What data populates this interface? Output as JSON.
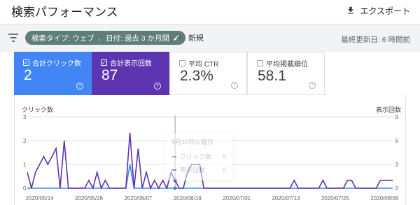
{
  "header": {
    "title": "検索パフォーマンス",
    "export_label": "エクスポート"
  },
  "filters": {
    "search_type_chip": "検索タイプ: ウェブ",
    "date_chip": "日付: 過去 3 か月間",
    "new_label": "新規",
    "last_updated": "最終更新日: 6 時間前"
  },
  "metrics": [
    {
      "label": "合計クリック数",
      "value": "2",
      "checked": true
    },
    {
      "label": "合計表示回数",
      "value": "87",
      "checked": true
    },
    {
      "label": "平均 CTR",
      "value": "2.3%",
      "checked": false
    },
    {
      "label": "平均掲載順位",
      "value": "58.1",
      "checked": false
    }
  ],
  "tooltip": {
    "date": "6月16日火曜日",
    "clicks_label": "クリック数",
    "clicks_value": "0",
    "impressions_label": "表示回数",
    "impressions_value": "0"
  },
  "chart_data": {
    "type": "line",
    "left_axis_title": "クリック数",
    "right_axis_title": "表示回数",
    "left_ticks": [
      "3",
      "2",
      "1",
      "0"
    ],
    "right_ticks": [
      "9",
      "6",
      "3",
      "0"
    ],
    "ylim_left": [
      0,
      3
    ],
    "ylim_right": [
      0,
      9
    ],
    "x_tick_labels": [
      "2020/05/14",
      "2020/05/26",
      "2020/06/07",
      "2020/06/19",
      "2020/07/01",
      "2020/07/13",
      "2020/07/25",
      "2020/08/06"
    ],
    "x_start_date": "2020/05/14",
    "x_count": 90,
    "colors": {
      "clicks": "#4285f4",
      "impressions": "#5e35b1",
      "grid": "#e0e0e0"
    },
    "series": [
      {
        "name": "クリック数",
        "values": [
          0,
          0,
          0,
          0,
          0,
          0,
          0,
          0,
          0,
          0,
          0,
          0,
          0,
          0,
          0,
          0,
          0,
          0,
          0,
          0,
          0,
          0,
          0,
          0,
          0,
          1,
          0,
          0,
          0,
          0,
          0,
          0,
          0,
          0,
          0,
          0,
          0,
          0,
          0,
          0,
          0,
          0,
          0,
          0,
          0,
          0,
          0,
          0,
          0,
          0,
          0,
          0,
          0,
          0,
          0,
          0,
          0,
          0,
          0,
          0,
          0,
          0,
          0,
          0,
          0,
          0,
          0,
          0,
          0,
          0,
          0,
          0,
          0,
          0,
          0,
          0,
          0,
          0,
          0,
          0,
          0,
          0,
          0,
          0,
          0,
          0,
          0,
          0,
          0,
          0
        ]
      },
      {
        "name": "表示回数",
        "values": [
          2,
          0,
          2,
          3,
          4,
          3,
          4,
          5,
          0,
          6,
          0,
          0,
          0,
          0,
          0,
          1,
          0,
          2,
          0,
          1,
          0,
          0,
          0,
          0,
          0,
          7,
          0,
          5,
          0,
          2,
          0,
          1,
          0,
          1,
          0,
          2,
          1,
          0,
          0,
          2,
          3,
          3,
          3,
          0,
          0,
          0,
          0,
          0,
          0,
          0,
          0,
          0,
          0,
          0,
          0,
          0,
          0,
          0,
          0,
          0,
          0,
          0,
          0,
          0,
          0,
          1,
          0,
          0,
          0,
          0,
          0,
          0,
          1,
          0,
          0,
          0,
          0,
          0,
          1,
          1,
          0,
          0,
          0,
          0,
          0,
          0,
          1,
          1,
          1,
          1
        ]
      }
    ]
  }
}
